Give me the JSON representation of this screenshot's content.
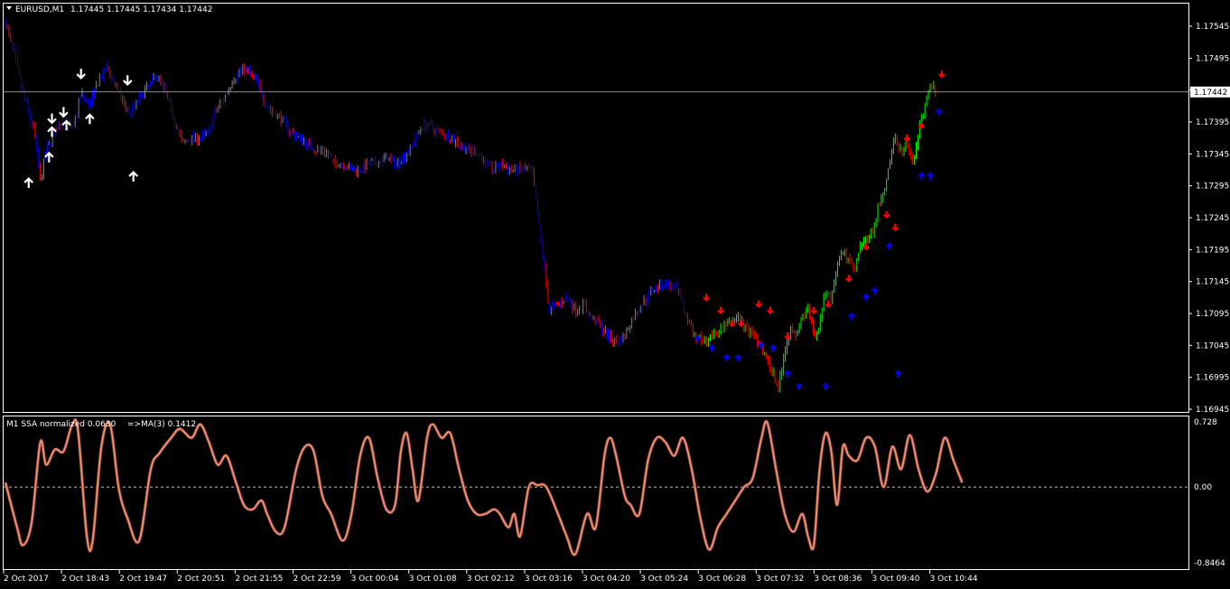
{
  "header": {
    "symbol": "EURUSD,M1",
    "ohlc": "1.17445 1.17445 1.17434 1.17442"
  },
  "indicator_header": {
    "name": "M1 SSA normalized 0.0630",
    "ma_label": "=>MA(3) 0.1412"
  },
  "colors": {
    "background": "#000000",
    "frame": "#ffffff",
    "price_line": "#c0c0c0",
    "candle_a": "#0000ff",
    "candle_b": "#808080",
    "candle_bear": "#ff0000",
    "trend_up": "#00ff00",
    "trend_down": "#ff0000",
    "ssa_line": "#e9967a",
    "up_arrow": "#ffffff",
    "down_arrow": "#ffffff",
    "signal_up": "#0000ff",
    "signal_down": "#ff0000"
  },
  "chart_data": [
    {
      "type": "candlestick",
      "title": "EURUSD,M1",
      "ylim": [
        1.16945,
        1.17565
      ],
      "y_ticks": [
        "1.17545",
        "1.17495",
        "1.17445",
        "1.17395",
        "1.17345",
        "1.17295",
        "1.17245",
        "1.17195",
        "1.17145",
        "1.17095",
        "1.17045",
        "1.16995",
        "1.16945"
      ],
      "current_price": "1.17442",
      "current_price_value": 1.17442,
      "x_ticks": [
        "2 Oct 2017",
        "2 Oct 18:43",
        "2 Oct 19:47",
        "2 Oct 20:51",
        "2 Oct 21:55",
        "2 Oct 22:59",
        "3 Oct 00:04",
        "3 Oct 01:08",
        "3 Oct 02:12",
        "3 Oct 03:16",
        "3 Oct 04:20",
        "3 Oct 05:24",
        "3 Oct 06:28",
        "3 Oct 07:32",
        "3 Oct 08:36",
        "3 Oct 09:40",
        "3 Oct 10:44"
      ],
      "close_path": [
        [
          0,
          1.1755
        ],
        [
          0.3,
          1.175
        ],
        [
          0.6,
          1.1744
        ],
        [
          1.0,
          1.1738
        ],
        [
          1.2,
          1.173
        ],
        [
          1.4,
          1.1735
        ],
        [
          1.7,
          1.1738
        ],
        [
          2.0,
          1.174
        ],
        [
          2.3,
          1.1738
        ],
        [
          2.6,
          1.1744
        ],
        [
          2.9,
          1.1742
        ],
        [
          3.2,
          1.1746
        ],
        [
          3.5,
          1.1748
        ],
        [
          3.8,
          1.1745
        ],
        [
          4.1,
          1.1742
        ],
        [
          4.3,
          1.1741
        ],
        [
          4.6,
          1.1743
        ],
        [
          4.9,
          1.1745
        ],
        [
          5.2,
          1.1747
        ],
        [
          5.5,
          1.1744
        ],
        [
          5.8,
          1.174
        ],
        [
          6.1,
          1.1736
        ],
        [
          6.4,
          1.1737
        ],
        [
          6.7,
          1.1737
        ],
        [
          7.0,
          1.1738
        ],
        [
          7.2,
          1.1741
        ],
        [
          7.5,
          1.1743
        ],
        [
          7.8,
          1.1746
        ],
        [
          8.0,
          1.1747
        ],
        [
          8.2,
          1.1748
        ],
        [
          8.4,
          1.1747
        ],
        [
          8.6,
          1.1746
        ],
        [
          8.8,
          1.1744
        ],
        [
          9.0,
          1.1742
        ],
        [
          9.2,
          1.1741
        ],
        [
          9.5,
          1.174
        ],
        [
          9.8,
          1.1738
        ],
        [
          10.1,
          1.1737
        ],
        [
          10.4,
          1.1736
        ],
        [
          10.7,
          1.1735
        ],
        [
          11.0,
          1.1735
        ],
        [
          11.3,
          1.1733
        ],
        [
          11.6,
          1.1733
        ],
        [
          11.9,
          1.1732
        ],
        [
          12.2,
          1.1732
        ],
        [
          12.5,
          1.1733
        ],
        [
          12.8,
          1.1733
        ],
        [
          13.1,
          1.1734
        ],
        [
          13.4,
          1.1733
        ],
        [
          13.7,
          1.1734
        ],
        [
          14.0,
          1.1736
        ],
        [
          14.2,
          1.1738
        ],
        [
          14.4,
          1.1739
        ],
        [
          14.6,
          1.1739
        ],
        [
          14.8,
          1.1738
        ],
        [
          15.0,
          1.1738
        ],
        [
          15.3,
          1.1737
        ],
        [
          15.6,
          1.1736
        ],
        [
          15.9,
          1.1735
        ],
        [
          16.2,
          1.1735
        ],
        [
          16.5,
          1.1733
        ],
        [
          16.8,
          1.1732
        ],
        [
          17.0,
          1.1733
        ],
        [
          17.3,
          1.1732
        ],
        [
          17.6,
          1.1732
        ],
        [
          17.9,
          1.1732
        ],
        [
          18.1,
          1.1732
        ],
        [
          18.3,
          1.1725
        ],
        [
          18.5,
          1.1718
        ],
        [
          18.7,
          1.171
        ],
        [
          19.0,
          1.1711
        ],
        [
          19.3,
          1.1712
        ],
        [
          19.6,
          1.171
        ],
        [
          19.9,
          1.1711
        ],
        [
          20.1,
          1.1709
        ],
        [
          20.4,
          1.1708
        ],
        [
          20.7,
          1.1706
        ],
        [
          21.0,
          1.1705
        ],
        [
          21.3,
          1.1706
        ],
        [
          21.6,
          1.1709
        ],
        [
          21.9,
          1.1711
        ],
        [
          22.2,
          1.1713
        ],
        [
          22.5,
          1.1714
        ],
        [
          22.8,
          1.1714
        ],
        [
          23.1,
          1.1713
        ],
        [
          23.4,
          1.1709
        ],
        [
          23.7,
          1.1706
        ],
        [
          24.0,
          1.1705
        ],
        [
          24.3,
          1.1706
        ],
        [
          24.6,
          1.1707
        ],
        [
          24.9,
          1.1708
        ],
        [
          25.2,
          1.1709
        ],
        [
          25.5,
          1.1707
        ],
        [
          25.8,
          1.1706
        ],
        [
          26.1,
          1.1703
        ],
        [
          26.4,
          1.17
        ],
        [
          26.6,
          1.1698
        ],
        [
          26.8,
          1.1704
        ],
        [
          27.0,
          1.1707
        ],
        [
          27.2,
          1.1706
        ],
        [
          27.4,
          1.1709
        ],
        [
          27.6,
          1.171
        ],
        [
          27.8,
          1.1706
        ],
        [
          28.0,
          1.1708
        ],
        [
          28.2,
          1.1713
        ],
        [
          28.4,
          1.1712
        ],
        [
          28.6,
          1.1717
        ],
        [
          28.8,
          1.1719
        ],
        [
          29.0,
          1.1718
        ],
        [
          29.2,
          1.1716
        ],
        [
          29.4,
          1.172
        ],
        [
          29.6,
          1.1721
        ],
        [
          29.8,
          1.1722
        ],
        [
          30.0,
          1.1726
        ],
        [
          30.2,
          1.1728
        ],
        [
          30.4,
          1.1733
        ],
        [
          30.6,
          1.1737
        ],
        [
          30.8,
          1.1735
        ],
        [
          31.0,
          1.1736
        ],
        [
          31.2,
          1.1733
        ],
        [
          31.4,
          1.1738
        ],
        [
          31.6,
          1.1742
        ],
        [
          31.8,
          1.1746
        ],
        [
          32.0,
          1.1744
        ]
      ],
      "trend_start_x": 23.4,
      "arrows_up": [
        [
          0.8,
          1.173
        ],
        [
          1.5,
          1.1734
        ],
        [
          1.6,
          1.1738
        ],
        [
          2.1,
          1.1739
        ],
        [
          2.9,
          1.174
        ],
        [
          4.4,
          1.1731
        ]
      ],
      "arrows_down": [
        [
          1.6,
          1.174
        ],
        [
          2.0,
          1.1741
        ],
        [
          2.6,
          1.1747
        ],
        [
          4.2,
          1.1746
        ]
      ],
      "signals_up": [
        [
          23.8,
          1.17055
        ],
        [
          24.3,
          1.1704
        ],
        [
          24.8,
          1.17025
        ],
        [
          25.2,
          1.17025
        ],
        [
          26.0,
          1.17045
        ],
        [
          26.4,
          1.1704
        ],
        [
          26.9,
          1.17
        ],
        [
          27.3,
          1.1698
        ],
        [
          28.2,
          1.1698
        ],
        [
          29.1,
          1.1709
        ],
        [
          29.6,
          1.1712
        ],
        [
          29.9,
          1.1713
        ],
        [
          30.4,
          1.172
        ],
        [
          30.7,
          1.17
        ],
        [
          31.5,
          1.1731
        ],
        [
          31.8,
          1.1731
        ],
        [
          32.1,
          1.1741
        ]
      ],
      "signals_down": [
        [
          24.1,
          1.1712
        ],
        [
          24.6,
          1.171
        ],
        [
          25.0,
          1.1708
        ],
        [
          25.3,
          1.1708
        ],
        [
          25.9,
          1.1711
        ],
        [
          26.3,
          1.171
        ],
        [
          26.9,
          1.1706
        ],
        [
          27.8,
          1.171
        ],
        [
          28.3,
          1.1711
        ],
        [
          29.0,
          1.1715
        ],
        [
          29.6,
          1.172
        ],
        [
          30.3,
          1.1725
        ],
        [
          30.6,
          1.1723
        ],
        [
          31.0,
          1.1737
        ],
        [
          31.5,
          1.1739
        ],
        [
          32.2,
          1.1747
        ]
      ]
    },
    {
      "type": "line",
      "title": "M1 SSA normalized 0.0630",
      "ylim": [
        -0.8464,
        0.728
      ],
      "y_ticks": [
        "0.728",
        "0.00",
        "-0.8464"
      ],
      "zero_value": 0,
      "series": [
        {
          "name": "SSA normalized",
          "values": [
            [
              0,
              0.05
            ],
            [
              0.4,
              -0.45
            ],
            [
              0.6,
              -0.65
            ],
            [
              0.9,
              -0.4
            ],
            [
              1.2,
              0.5
            ],
            [
              1.4,
              0.25
            ],
            [
              1.7,
              0.42
            ],
            [
              2.0,
              0.4
            ],
            [
              2.3,
              0.7
            ],
            [
              2.5,
              0.62
            ],
            [
              2.8,
              -0.55
            ],
            [
              3.0,
              -0.6
            ],
            [
              3.3,
              0.45
            ],
            [
              3.6,
              0.7
            ],
            [
              3.9,
              -0.02
            ],
            [
              4.2,
              -0.35
            ],
            [
              4.6,
              -0.6
            ],
            [
              5.0,
              0.2
            ],
            [
              5.3,
              0.38
            ],
            [
              5.7,
              0.55
            ],
            [
              6.0,
              0.65
            ],
            [
              6.4,
              0.55
            ],
            [
              6.7,
              0.7
            ],
            [
              7.0,
              0.5
            ],
            [
              7.3,
              0.25
            ],
            [
              7.6,
              0.35
            ],
            [
              7.9,
              0.08
            ],
            [
              8.2,
              -0.2
            ],
            [
              8.5,
              -0.25
            ],
            [
              8.8,
              -0.15
            ],
            [
              9.0,
              -0.3
            ],
            [
              9.3,
              -0.5
            ],
            [
              9.6,
              -0.45
            ],
            [
              10.0,
              0.2
            ],
            [
              10.3,
              0.45
            ],
            [
              10.6,
              0.4
            ],
            [
              10.9,
              -0.1
            ],
            [
              11.2,
              -0.3
            ],
            [
              11.6,
              -0.6
            ],
            [
              11.9,
              -0.3
            ],
            [
              12.2,
              0.35
            ],
            [
              12.5,
              0.55
            ],
            [
              12.8,
              0.1
            ],
            [
              13.1,
              -0.25
            ],
            [
              13.4,
              -0.2
            ],
            [
              13.6,
              0.4
            ],
            [
              13.8,
              0.6
            ],
            [
              14.0,
              0.2
            ],
            [
              14.2,
              -0.15
            ],
            [
              14.5,
              0.55
            ],
            [
              14.7,
              0.7
            ],
            [
              15.0,
              0.55
            ],
            [
              15.3,
              0.6
            ],
            [
              15.6,
              0.2
            ],
            [
              15.9,
              -0.15
            ],
            [
              16.2,
              -0.3
            ],
            [
              16.5,
              -0.3
            ],
            [
              16.8,
              -0.25
            ],
            [
              17.0,
              -0.3
            ],
            [
              17.3,
              -0.45
            ],
            [
              17.5,
              -0.3
            ],
            [
              17.7,
              -0.55
            ],
            [
              18.0,
              0.0
            ],
            [
              18.3,
              0.02
            ],
            [
              18.6,
              0.0
            ],
            [
              19.0,
              -0.3
            ],
            [
              19.3,
              -0.55
            ],
            [
              19.6,
              -0.75
            ],
            [
              20.0,
              -0.3
            ],
            [
              20.3,
              -0.45
            ],
            [
              20.6,
              0.35
            ],
            [
              20.8,
              0.55
            ],
            [
              21.0,
              0.35
            ],
            [
              21.3,
              -0.1
            ],
            [
              21.5,
              -0.2
            ],
            [
              21.8,
              -0.3
            ],
            [
              22.1,
              0.3
            ],
            [
              22.4,
              0.55
            ],
            [
              22.7,
              0.5
            ],
            [
              23.0,
              0.35
            ],
            [
              23.3,
              0.55
            ],
            [
              23.6,
              0.2
            ],
            [
              23.9,
              -0.35
            ],
            [
              24.2,
              -0.7
            ],
            [
              24.5,
              -0.45
            ],
            [
              24.8,
              -0.3
            ],
            [
              25.1,
              -0.15
            ],
            [
              25.4,
              0.0
            ],
            [
              25.7,
              0.1
            ],
            [
              26.0,
              0.55
            ],
            [
              26.2,
              0.72
            ],
            [
              26.5,
              0.2
            ],
            [
              26.8,
              -0.3
            ],
            [
              27.1,
              -0.5
            ],
            [
              27.4,
              -0.3
            ],
            [
              27.6,
              -0.55
            ],
            [
              27.8,
              -0.65
            ],
            [
              28.0,
              0.2
            ],
            [
              28.2,
              0.6
            ],
            [
              28.4,
              0.4
            ],
            [
              28.6,
              -0.2
            ],
            [
              28.8,
              0.45
            ],
            [
              29.0,
              0.35
            ],
            [
              29.3,
              0.3
            ],
            [
              29.6,
              0.55
            ],
            [
              29.9,
              0.45
            ],
            [
              30.2,
              0.0
            ],
            [
              30.5,
              0.45
            ],
            [
              30.8,
              0.2
            ],
            [
              31.1,
              0.58
            ],
            [
              31.4,
              0.2
            ],
            [
              31.7,
              -0.05
            ],
            [
              32.0,
              0.15
            ],
            [
              32.3,
              0.55
            ],
            [
              32.6,
              0.3
            ],
            [
              32.9,
              0.05
            ]
          ]
        }
      ]
    }
  ]
}
